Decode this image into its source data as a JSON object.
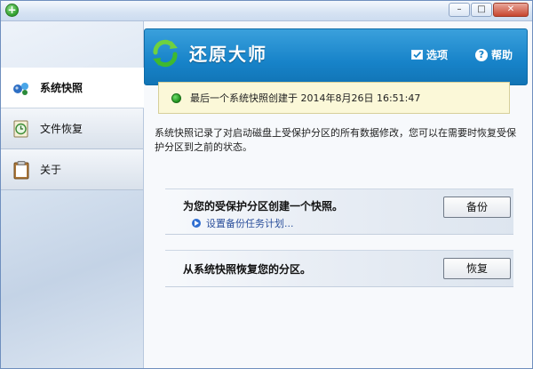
{
  "window": {
    "icon": "green-plus-icon",
    "controls": {
      "minimize": "–",
      "maximize": "□",
      "close": "✕"
    }
  },
  "sidebar": {
    "items": [
      {
        "label": "系统快照",
        "icon": "network-globe-icon",
        "active": true
      },
      {
        "label": "文件恢复",
        "icon": "clock-document-icon",
        "active": false
      },
      {
        "label": "关于",
        "icon": "clipboard-icon",
        "active": false
      }
    ]
  },
  "header": {
    "title": "还原大师",
    "logo": "green-refresh-arrows-icon",
    "options_label": "选项",
    "help_label": "帮助"
  },
  "notice": {
    "text": "最后一个系统快照创建于 2014年8月26日 16:51:47",
    "status_color": "#2a9e27"
  },
  "description": "系统快照记录了对启动磁盘上受保护分区的所有数据修改，您可以在需要时恢复受保护分区到之前的状态。",
  "backup": {
    "label": "为您的受保护分区创建一个快照。",
    "schedule_link": "设置备份任务计划...",
    "button": "备份"
  },
  "restore": {
    "label": "从系统快照恢复您的分区。",
    "button": "恢复"
  },
  "colors": {
    "banner": "#1783c9",
    "notice_bg": "#fbf8d8",
    "link": "#2b4f9b"
  }
}
